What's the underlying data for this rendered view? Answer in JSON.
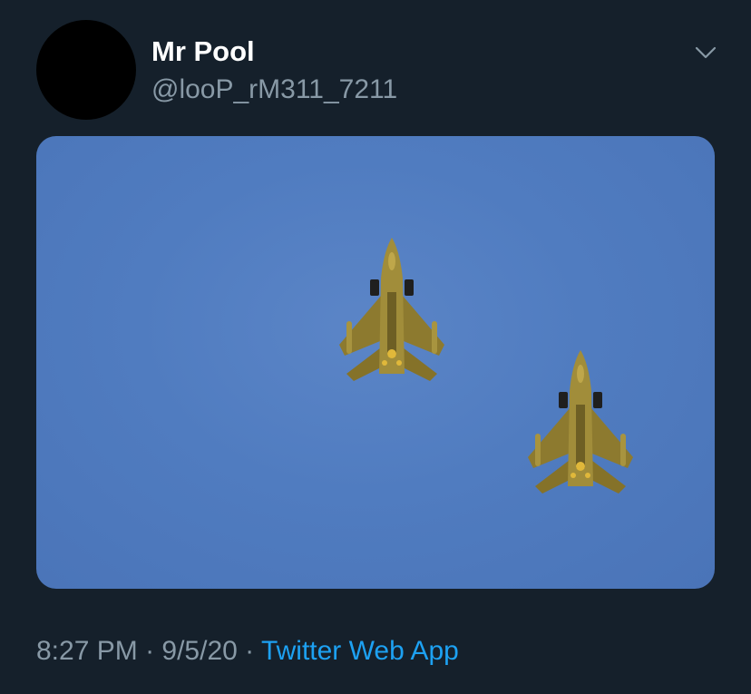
{
  "tweet": {
    "display_name": "Mr Pool",
    "handle": "@looP_rM311_7211",
    "menu_icon": "chevron-down-icon",
    "time": "8:27 PM",
    "separator": " · ",
    "date": "9/5/20",
    "source": "Twitter Web App",
    "colors": {
      "background": "#15202b",
      "name": "#ffffff",
      "muted": "#8899a6",
      "link": "#1da1f2",
      "sky": "#507cc0",
      "jet": "#9a8636"
    }
  }
}
